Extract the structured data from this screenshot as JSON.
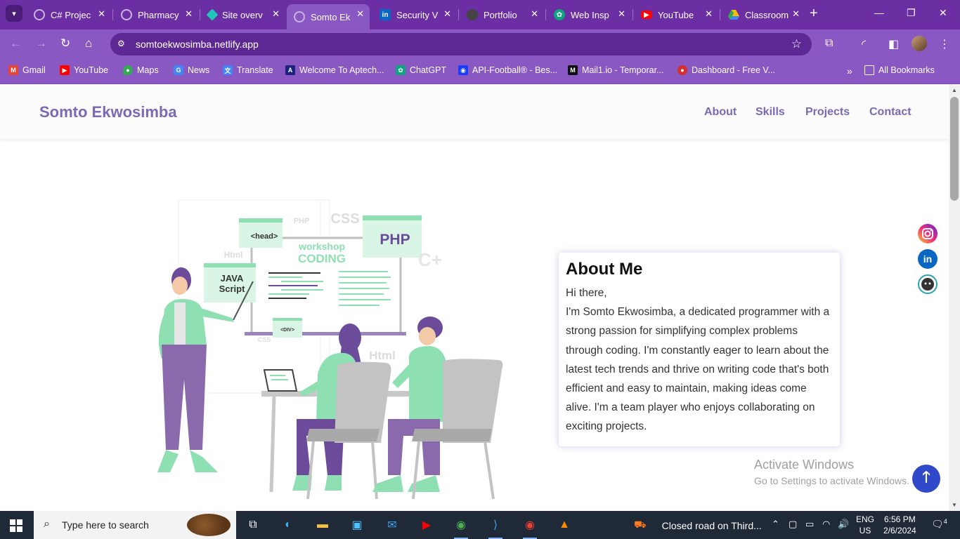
{
  "browser": {
    "tabs": [
      {
        "title": "C# Projec",
        "icon": "loading-icon"
      },
      {
        "title": "Pharmacy",
        "icon": "loading-icon"
      },
      {
        "title": "Site overv",
        "icon": "netlify-icon"
      },
      {
        "title": "Somto Ek",
        "icon": "loading-icon",
        "active": true
      },
      {
        "title": "Security V",
        "icon": "linkedin-icon"
      },
      {
        "title": "Portfolio",
        "icon": "github-icon"
      },
      {
        "title": "Web Insp",
        "icon": "chatgpt-icon"
      },
      {
        "title": "YouTube",
        "icon": "youtube-icon"
      },
      {
        "title": "Classroom",
        "icon": "drive-icon"
      }
    ],
    "url": "somtoekwosimba.netlify.app",
    "bookmarks": [
      {
        "label": "Gmail",
        "icon": "gmail-icon",
        "color": "#ea4335"
      },
      {
        "label": "YouTube",
        "icon": "youtube-icon",
        "color": "#ff0000"
      },
      {
        "label": "Maps",
        "icon": "maps-icon",
        "color": "#34a853"
      },
      {
        "label": "News",
        "icon": "news-icon",
        "color": "#4285f4"
      },
      {
        "label": "Translate",
        "icon": "translate-icon",
        "color": "#4285f4"
      },
      {
        "label": "Welcome To Aptech...",
        "icon": "aptech-icon",
        "color": "#1a237e"
      },
      {
        "label": "ChatGPT",
        "icon": "chatgpt-icon",
        "color": "#10a37f"
      },
      {
        "label": "API-Football® - Bes...",
        "icon": "api-football-icon",
        "color": "#1a3cff"
      },
      {
        "label": "Mail1.io - Temporar...",
        "icon": "mail1-icon",
        "color": "#111111"
      },
      {
        "label": "Dashboard - Free V...",
        "icon": "dashboard-icon",
        "color": "#d32f2f"
      }
    ],
    "all_bookmarks": "All Bookmarks"
  },
  "site": {
    "brand": "Somto Ekwosimba",
    "nav": [
      "About",
      "Skills",
      "Projects",
      "Contact"
    ],
    "about": {
      "title": "About Me",
      "greeting": "Hi there,",
      "body": "I'm Somto Ekwosimba, a dedicated programmer with a strong passion for simplifying complex problems through coding. I'm constantly eager to learn about the latest tech trends and thrive on writing code that's both efficient and easy to maintain, making ideas come alive. I'm a team player who enjoys collaborating on exciting projects."
    },
    "illustration_labels": {
      "head": "<head>",
      "php_small": "PHP",
      "css_big": "CSS",
      "php_big": "PHP",
      "workshop": "workshop",
      "coding": "CODING",
      "html_small": "Html",
      "java": "JAVA",
      "script": "Script",
      "cplus": "C+",
      "div": "<DIV>",
      "css_small": "CSS",
      "html_big": "Html"
    },
    "social": [
      "instagram-icon",
      "linkedin-icon",
      "github-icon"
    ],
    "accent": "#7b69b5"
  },
  "watermark": {
    "line1": "Activate Windows",
    "line2": "Go to Settings to activate Windows."
  },
  "taskbar": {
    "search_placeholder": "Type here to search",
    "weather": "Closed road on Third...",
    "lang1": "ENG",
    "lang2": "US",
    "time": "6:56 PM",
    "date": "2/6/2024",
    "notifications": "4"
  }
}
